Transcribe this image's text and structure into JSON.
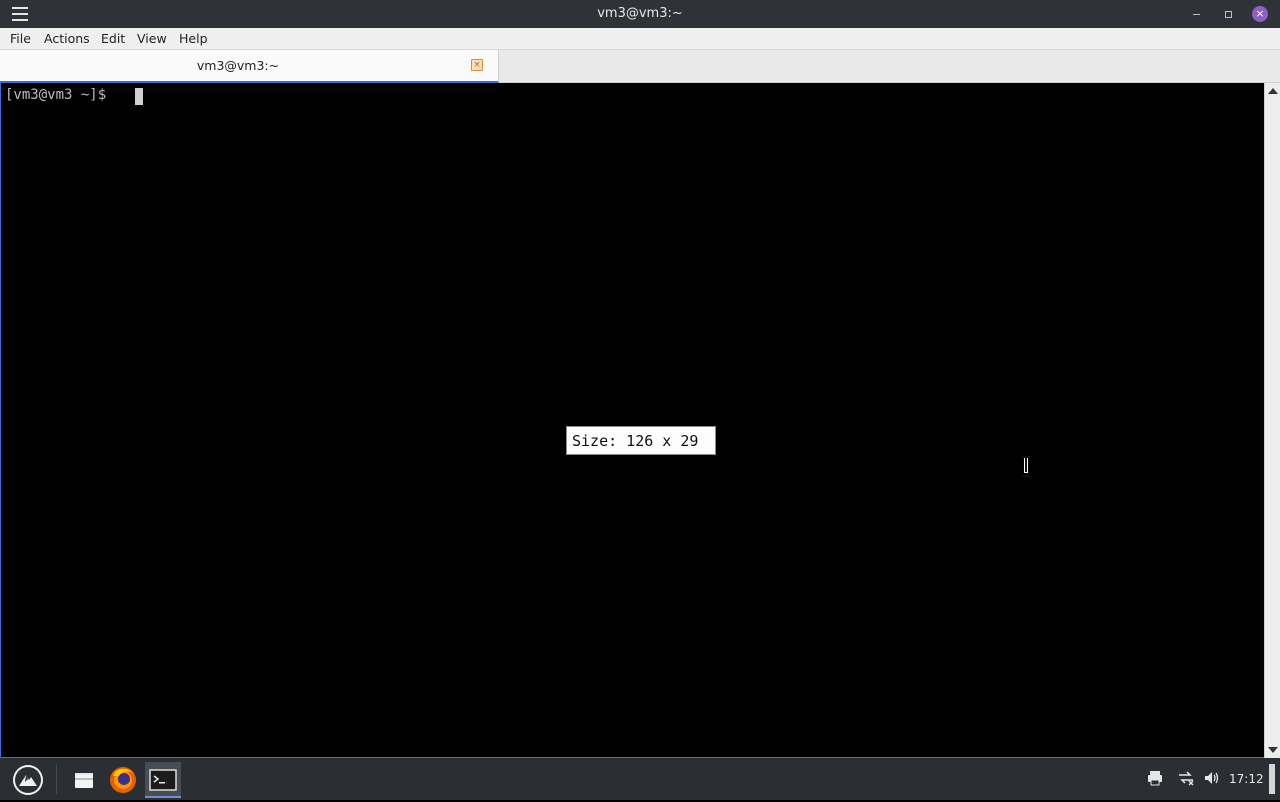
{
  "window": {
    "title": "vm3@vm3:~",
    "close_symbol": "×"
  },
  "menu": {
    "items": [
      "File",
      "Actions",
      "Edit",
      "View",
      "Help"
    ]
  },
  "tabs": [
    {
      "label": "vm3@vm3:~",
      "close_symbol": "×"
    }
  ],
  "terminal": {
    "prompt": "[vm3@vm3 ~]$ ",
    "size_tooltip": "Size: 126 x 29"
  },
  "taskbar": {
    "clock": "17:12",
    "apps": [
      "files-icon",
      "firefox-icon",
      "terminal-icon"
    ]
  },
  "colors": {
    "accent": "#3a6fd8",
    "close_button": "#8e5fc7",
    "titlebar": "#2f3237",
    "taskbar": "#2b2e33"
  }
}
